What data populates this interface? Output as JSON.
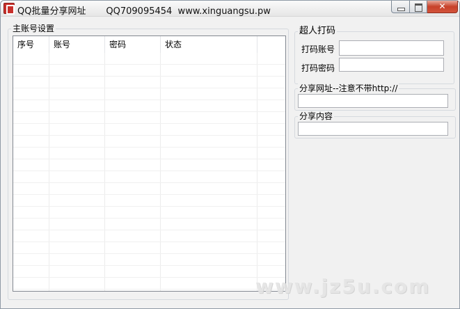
{
  "window": {
    "title": "QQ批量分享网址       QQ709095454  www.xinguangsu.pw",
    "icon": "app-icon"
  },
  "accounts": {
    "group_label": "主账号设置",
    "columns": [
      "序号",
      "账号",
      "密码",
      "状态"
    ],
    "rows": []
  },
  "captcha": {
    "group_label": "超人打码",
    "account_label": "打码账号",
    "account_value": "",
    "password_label": "打码密码",
    "password_value": ""
  },
  "share_url": {
    "group_label": "分享网址--注意不带http://",
    "value": ""
  },
  "share_content": {
    "group_label": "分享内容",
    "value": ""
  },
  "watermark": "www.jz5u.com"
}
